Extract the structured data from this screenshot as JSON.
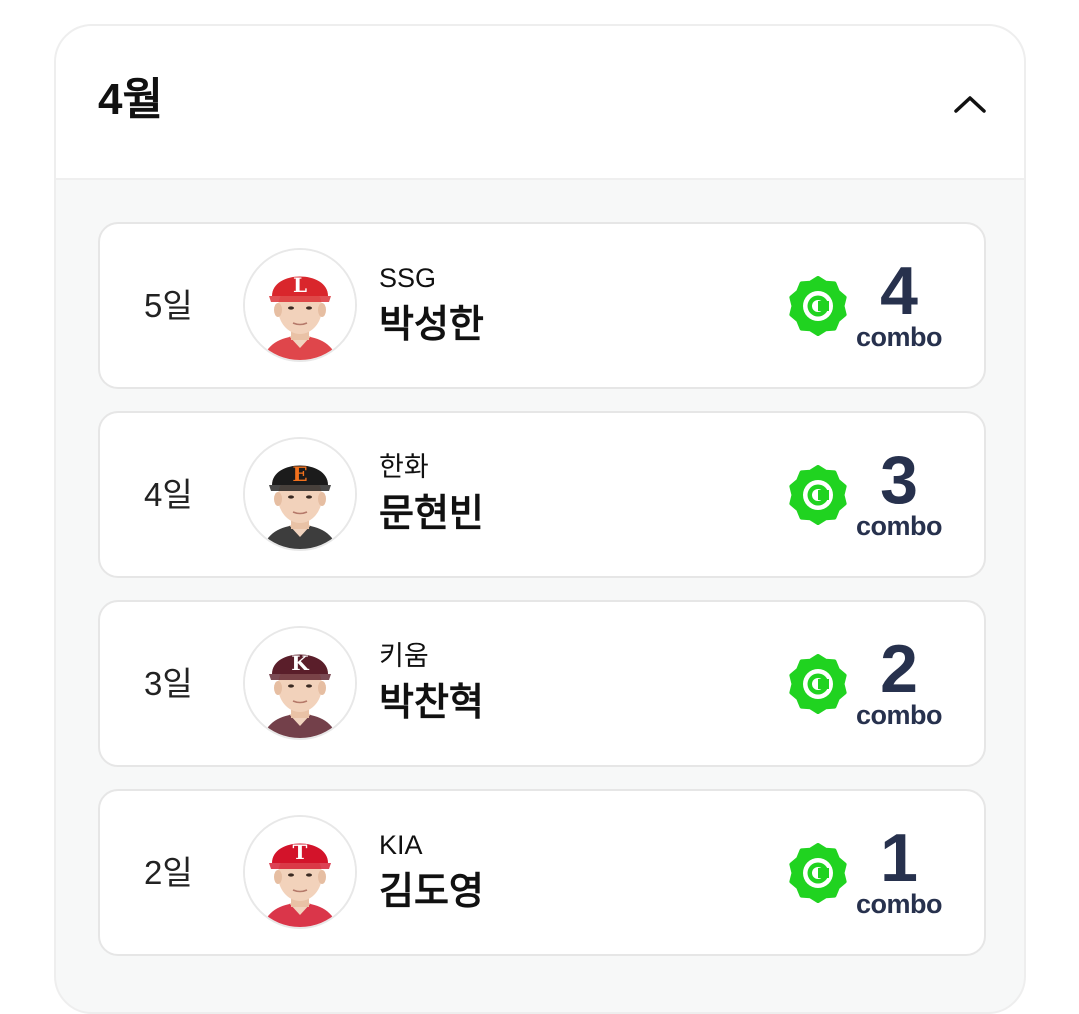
{
  "section": {
    "title": "4월",
    "collapse_icon": "chevron-up-icon"
  },
  "colors": {
    "badge_green": "#20d320",
    "combo_text": "#27314d"
  },
  "entries": [
    {
      "day": "5일",
      "team": "SSG",
      "name": "박성한",
      "combo": "4",
      "combo_label": "combo",
      "cap_color": "#d9262c",
      "cap_letter": "L",
      "letter_color": "#ffffff"
    },
    {
      "day": "4일",
      "team": "한화",
      "name": "문현빈",
      "combo": "3",
      "combo_label": "combo",
      "cap_color": "#1b1b1b",
      "cap_letter": "E",
      "letter_color": "#f2711c"
    },
    {
      "day": "3일",
      "team": "키움",
      "name": "박찬혁",
      "combo": "2",
      "combo_label": "combo",
      "cap_color": "#5a1e2a",
      "cap_letter": "K",
      "letter_color": "#ffffff"
    },
    {
      "day": "2일",
      "team": "KIA",
      "name": "김도영",
      "combo": "1",
      "combo_label": "combo",
      "cap_color": "#d3132a",
      "cap_letter": "T",
      "letter_color": "#ffffff"
    }
  ]
}
